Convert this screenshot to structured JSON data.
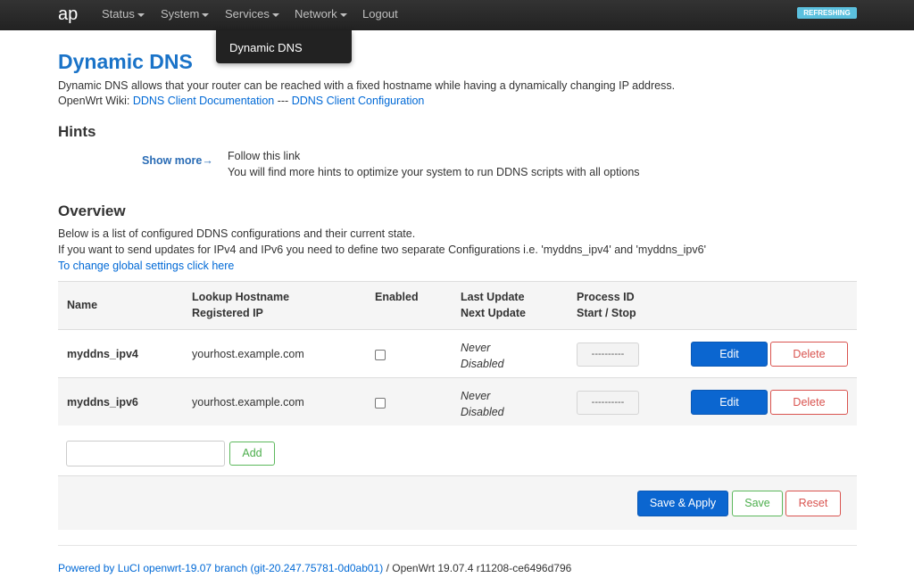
{
  "nav": {
    "brand": "ap",
    "items": [
      "Status",
      "System",
      "Services",
      "Network",
      "Logout"
    ],
    "badge": "REFRESHING"
  },
  "dropdown": {
    "item": "Dynamic DNS"
  },
  "page": {
    "title": "Dynamic DNS",
    "description": "Dynamic DNS allows that your router can be reached with a fixed hostname while having a dynamically changing IP address.",
    "wiki_prefix": "OpenWrt Wiki:",
    "wiki_link1": "DDNS Client Documentation",
    "wiki_sep": "---",
    "wiki_link2": "DDNS Client Configuration"
  },
  "hints": {
    "title": "Hints",
    "show_more": "Show more→",
    "line1": "Follow this link",
    "line2": "You will find more hints to optimize your system to run DDNS scripts with all options"
  },
  "overview": {
    "title": "Overview",
    "line1": "Below is a list of configured DDNS configurations and their current state.",
    "line2": "If you want to send updates for IPv4 and IPv6 you need to define two separate Configurations i.e. 'myddns_ipv4' and 'myddns_ipv6'",
    "global_link": "To change global settings click here"
  },
  "table": {
    "headers": {
      "name": "Name",
      "lookup": "Lookup Hostname",
      "registered": "Registered IP",
      "enabled": "Enabled",
      "last_update": "Last Update",
      "next_update": "Next Update",
      "process": "Process ID",
      "start_stop": "Start / Stop"
    },
    "rows": [
      {
        "name": "myddns_ipv4",
        "host": "yourhost.example.com",
        "enabled": false,
        "last": "Never",
        "next": "Disabled",
        "process": "----------",
        "edit": "Edit",
        "delete": "Delete"
      },
      {
        "name": "myddns_ipv6",
        "host": "yourhost.example.com",
        "enabled": false,
        "last": "Never",
        "next": "Disabled",
        "process": "----------",
        "edit": "Edit",
        "delete": "Delete"
      }
    ]
  },
  "add": {
    "value": "",
    "label": "Add"
  },
  "actions": {
    "apply": "Save & Apply",
    "save": "Save",
    "reset": "Reset"
  },
  "footer": {
    "link": "Powered by LuCI openwrt-19.07 branch (git-20.247.75781-0d0ab01)",
    "text": " / OpenWrt 19.07.4 r11208-ce6496d796"
  }
}
